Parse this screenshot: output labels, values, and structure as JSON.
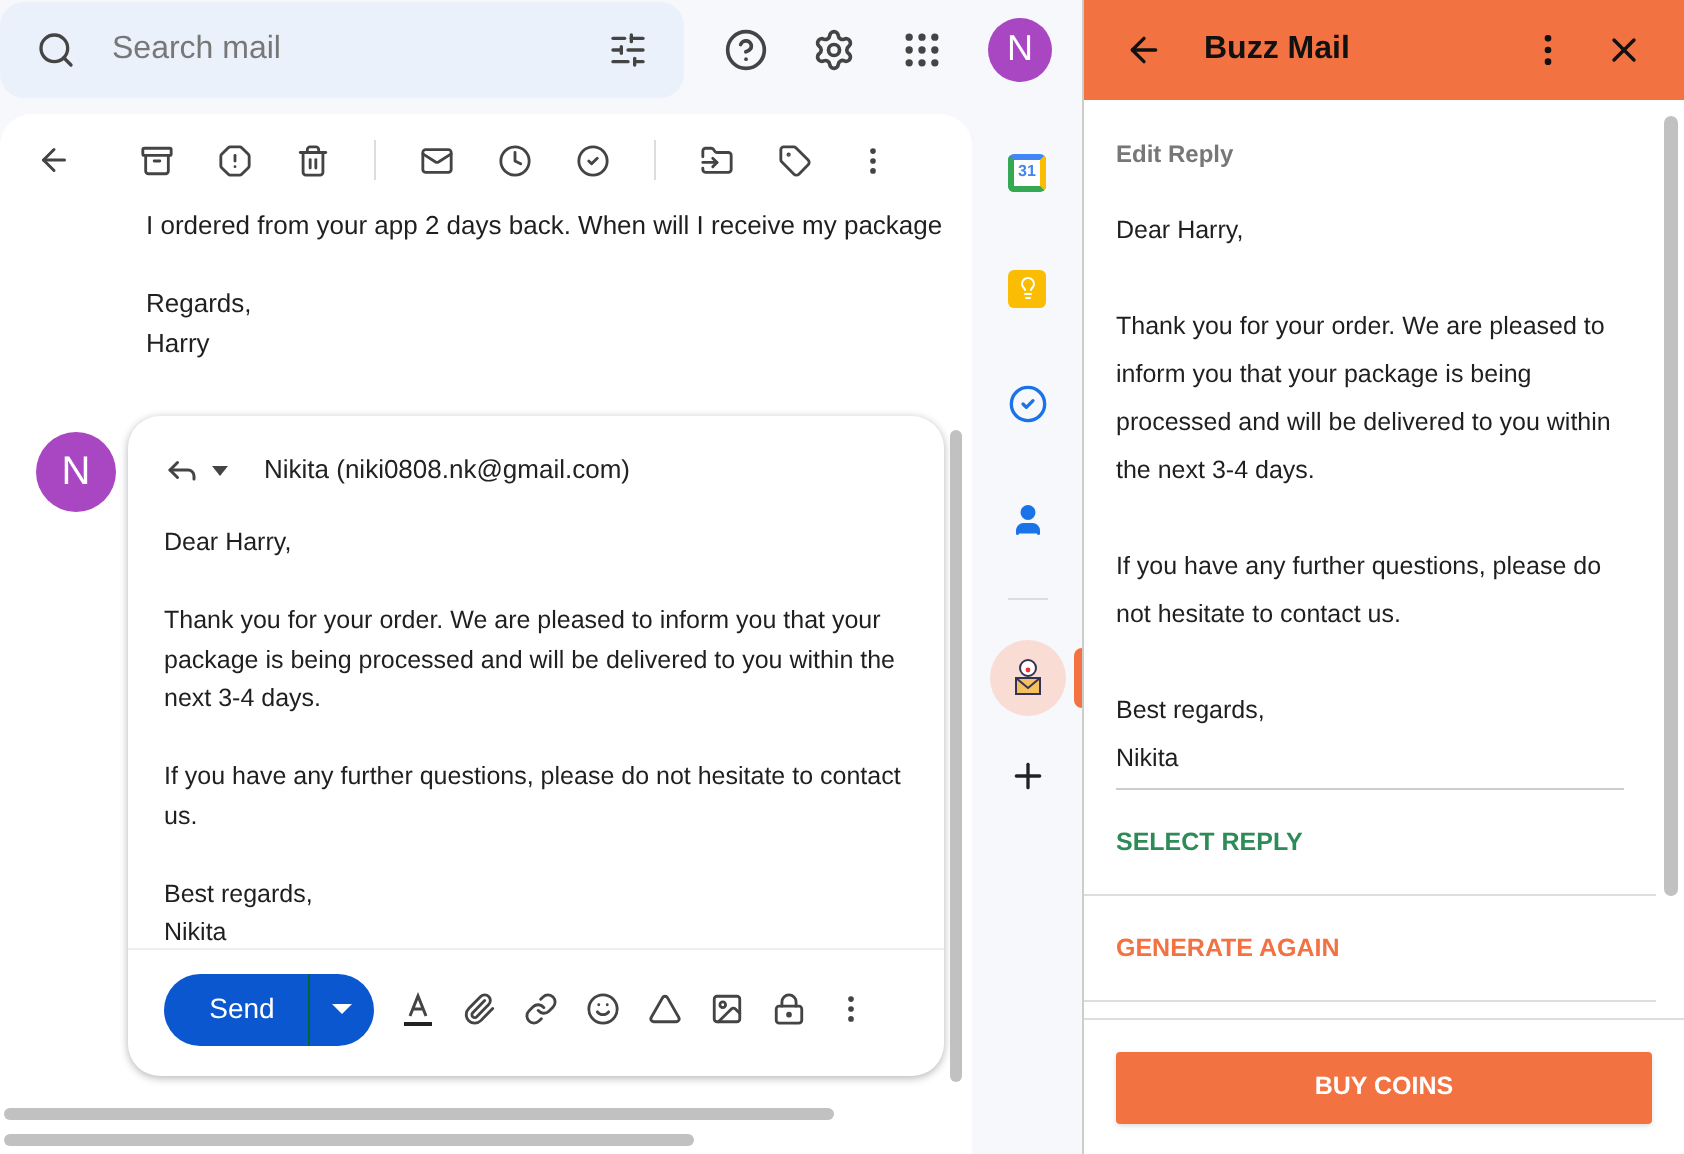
{
  "search": {
    "placeholder": "Search mail"
  },
  "account": {
    "initial": "N"
  },
  "message": {
    "paragraphs": [
      "I ordered from your app 2 days back. When will I receive my package",
      "Regards,\nHarry"
    ]
  },
  "reply": {
    "initial": "N",
    "recipient": "Nikita (niki0808.nk@gmail.com)",
    "paragraphs": [
      "Dear Harry,",
      "Thank you for your order. We are pleased to inform you that your package is being processed and will be delivered to you within the next 3-4 days.",
      "If you have any further questions, please do not hesitate to contact us.",
      "Best regards,\nNikita"
    ],
    "send": "Send"
  },
  "side_apps": [
    {
      "kind": "calendar",
      "label": "31",
      "selected": false
    },
    {
      "kind": "keep",
      "selected": false
    },
    {
      "kind": "tasks",
      "selected": false
    },
    {
      "kind": "contacts",
      "selected": false
    },
    {
      "kind": "buzz",
      "selected": true
    }
  ],
  "buzz": {
    "title": "Buzz Mail",
    "section": "Edit Reply",
    "paragraphs": [
      "Dear Harry,",
      "Thank you for your order. We are pleased to inform you that your package is being processed and will be delivered to you within the next 3-4 days.",
      "If you have any further questions, please do not hesitate to contact us.",
      "Best regards,\nNikita"
    ],
    "actions": [
      {
        "kind": "confirm",
        "label": "SELECT REPLY"
      },
      {
        "kind": "retry",
        "label": "GENERATE AGAIN"
      }
    ],
    "buy": "BUY COINS"
  }
}
